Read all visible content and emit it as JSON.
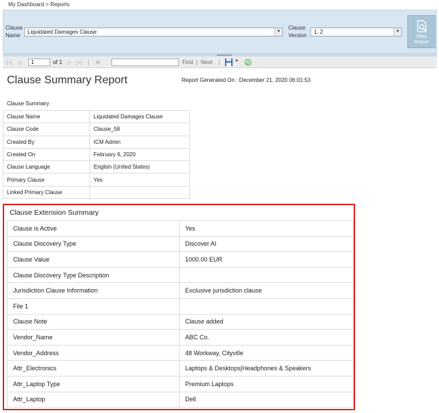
{
  "breadcrumb": "My Dashboard > Reports",
  "params": {
    "clause_name_label_1": "Clause",
    "clause_name_label_2": "Name",
    "clause_name_value": "Liquidated Damages Clause",
    "clause_version_label_1": "Clause",
    "clause_version_label_2": "Version",
    "clause_version_value": "1, 2",
    "view_report_label_1": "View",
    "view_report_label_2": "Report"
  },
  "toolbar": {
    "page_value": "1",
    "of_label": "of 1",
    "find_label": "Find",
    "separator": "|",
    "next_label": "Next"
  },
  "report": {
    "title": "Clause Summary Report",
    "generated": "Report Generated On : December 21, 2020 06:01:53"
  },
  "summary": {
    "heading": "Clause Summary",
    "rows": [
      {
        "key": "Clause Name",
        "value": "Liquidated Damages Clause"
      },
      {
        "key": "Clause Code",
        "value": "Clause_58"
      },
      {
        "key": "Created By",
        "value": "ICM Admin"
      },
      {
        "key": "Created On",
        "value": "February 6, 2020"
      },
      {
        "key": "Clause Language",
        "value": "English (United States)"
      },
      {
        "key": "Primary Clause",
        "value": "Yes"
      },
      {
        "key": "Linked Primary Clause",
        "value": ""
      }
    ]
  },
  "extension": {
    "heading": "Clause Extension Summary",
    "rows": [
      {
        "key": "Clause is Active",
        "value": "Yes"
      },
      {
        "key": "Clause Discovery Type",
        "value": "Discover AI"
      },
      {
        "key": "Clause Value",
        "value": "1000.00 EUR"
      },
      {
        "key": "Clause Discovery Type Description",
        "value": ""
      },
      {
        "key": "Jurisdiction Clause Information",
        "value": "Exclusive jurisdiction clause"
      },
      {
        "key": "File 1",
        "value": ""
      },
      {
        "key": "Clause Note",
        "value": "Clause added"
      },
      {
        "key": "Vendor_Name",
        "value": "ABC Co."
      },
      {
        "key": "Vendor_Address",
        "value": "48 Workway, Cityville"
      },
      {
        "key": "Attr_Electronics",
        "value": "Laptops & Desktops|Headphones & Speakers"
      },
      {
        "key": "Attr_Laptop Type",
        "value": "Premium Laptops"
      },
      {
        "key": "Attr_Laptop",
        "value": "Dell"
      }
    ]
  },
  "colors": {
    "panel_bg": "#d8e6f2",
    "highlight_border": "#e02020",
    "view_report_bg": "#a9c5d6"
  },
  "icons": {
    "dropdown": "chevron-down-icon",
    "view_report": "report-search-icon",
    "first_page": "first-page-icon",
    "prev_page": "prev-page-icon",
    "next_page": "next-page-icon",
    "last_page": "last-page-icon",
    "back": "back-icon",
    "export": "export-save-icon",
    "refresh": "refresh-icon"
  }
}
